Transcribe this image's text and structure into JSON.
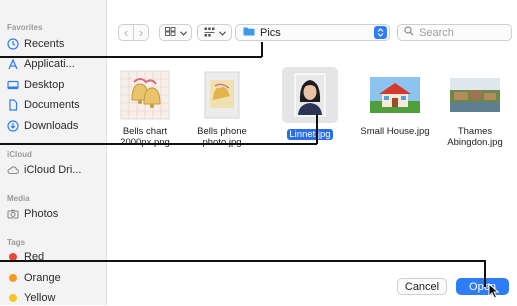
{
  "sidebar": {
    "favorites_label": "Favorites",
    "favorites": [
      {
        "label": "Recents",
        "icon": "clock-icon"
      },
      {
        "label": "Applicati...",
        "icon": "applications-icon"
      },
      {
        "label": "Desktop",
        "icon": "desktop-icon"
      },
      {
        "label": "Documents",
        "icon": "document-icon"
      },
      {
        "label": "Downloads",
        "icon": "download-icon"
      }
    ],
    "icloud_label": "iCloud",
    "icloud": [
      {
        "label": "iCloud Dri...",
        "icon": "cloud-icon"
      }
    ],
    "media_label": "Media",
    "media": [
      {
        "label": "Photos",
        "icon": "camera-icon"
      }
    ],
    "tags_label": "Tags",
    "tags": [
      {
        "label": "Red",
        "color": "#e8453c"
      },
      {
        "label": "Orange",
        "color": "#f39a1f"
      },
      {
        "label": "Yellow",
        "color": "#f5c722"
      }
    ]
  },
  "toolbar": {
    "back_glyph": "‹",
    "forward_glyph": "›",
    "folder": "Pics",
    "search_placeholder": "Search"
  },
  "files": [
    {
      "name": "Bells chart 2000px.png",
      "selected": false
    },
    {
      "name": "Bells phone photo.jpg",
      "selected": false
    },
    {
      "name": "Linnet.jpg",
      "selected": true
    },
    {
      "name": "Small House.jpg",
      "selected": false
    },
    {
      "name": "Thames Abingdon.jpg",
      "selected": false
    }
  ],
  "footer": {
    "cancel_label": "Cancel",
    "open_label": "Open"
  },
  "colors": {
    "accent": "#2f7df6",
    "selection": "#2a6fe8"
  }
}
